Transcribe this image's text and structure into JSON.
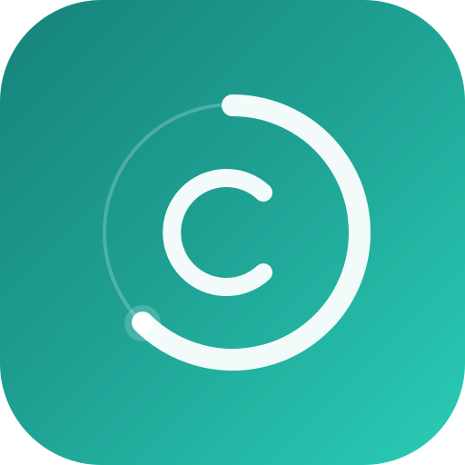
{
  "icon": {
    "name": "app-icon",
    "colors": {
      "gradient_start": "#16837a",
      "gradient_mid": "#1e9f92",
      "gradient_end": "#2acdb6",
      "stroke": "#f2fbfa",
      "track": "#ffffff"
    },
    "progress_fraction": 0.68
  }
}
